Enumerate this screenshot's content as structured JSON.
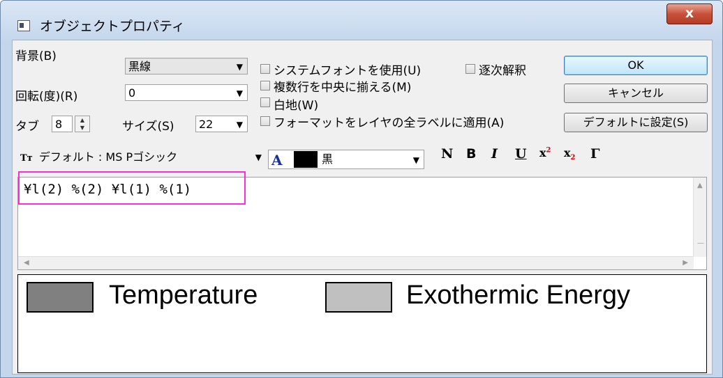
{
  "window": {
    "title": "オブジェクトプロパティ",
    "close_glyph": "x"
  },
  "labels": {
    "background": "背景(B)",
    "rotation": "回転(度)(R)",
    "tab": "タブ",
    "size": "サイズ(S)"
  },
  "fields": {
    "background": "黒線",
    "rotation": "0",
    "tab": "8",
    "size": "22",
    "font": "デフォルト : MS Pゴシック",
    "color_name": "黒",
    "font_icon": "Tт",
    "color_icon": "A"
  },
  "checkboxes": {
    "system_font": "システムフォントを使用(U)",
    "sequential": "逐次解釈",
    "center_multi": "複数行を中央に揃える(M)",
    "white_bg": "白地(W)",
    "apply_all": "フォーマットをレイヤの全ラベルに適用(A)"
  },
  "buttons": {
    "ok": "OK",
    "cancel": "キャンセル",
    "set_default": "デフォルトに設定(S)"
  },
  "format_toolbar": {
    "normal": "N",
    "bold": "B",
    "italic": "I",
    "underline": "U",
    "superscript": "x",
    "superscript_sup": "2",
    "subscript": "x",
    "subscript_sub": "2",
    "greek": "Γ"
  },
  "editor": {
    "text": "¥l(2) %(2) ¥l(1) %(1)"
  },
  "preview": {
    "items": [
      {
        "label": "Temperature",
        "color": "#808080"
      },
      {
        "label": "Exothermic Energy",
        "color": "#c0c0c0"
      }
    ]
  }
}
